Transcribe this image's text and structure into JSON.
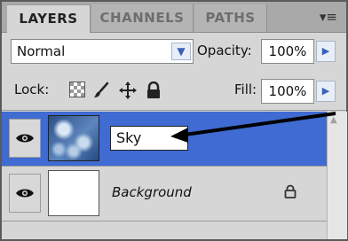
{
  "tabs": [
    {
      "label": "LAYERS",
      "active": true
    },
    {
      "label": "CHANNELS",
      "active": false
    },
    {
      "label": "PATHS",
      "active": false
    }
  ],
  "panel_menu_icon": "panel-menu-icon",
  "blend_mode": {
    "value": "Normal"
  },
  "opacity": {
    "label": "Opacity:",
    "value": "100%"
  },
  "lock": {
    "label": "Lock:",
    "icons": [
      "lock-transparent-pixels-icon",
      "lock-image-pixels-icon",
      "lock-position-icon",
      "lock-all-icon"
    ]
  },
  "fill": {
    "label": "Fill:",
    "value": "100%"
  },
  "layers": [
    {
      "name": "Sky",
      "editing": true,
      "selected": true,
      "visible": true
    },
    {
      "name": "Background",
      "editing": false,
      "selected": false,
      "visible": true,
      "locked": true
    }
  ],
  "colors": {
    "selection": "#3f6bd2",
    "panel": "#d6d6d6",
    "tab_bar": "#a9a9a9"
  }
}
